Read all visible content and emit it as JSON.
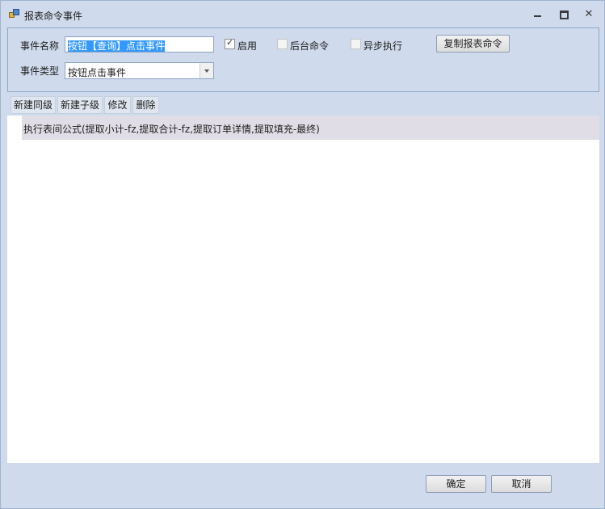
{
  "window": {
    "title": "报表命令事件",
    "icon": "app-window-icon",
    "close_glyph": "✕"
  },
  "form": {
    "event_name_label": "事件名称",
    "event_name_value": "按钮【查询】点击事件",
    "enable_label": "启用",
    "enable_checked": true,
    "background_label": "后台命令",
    "background_checked": false,
    "async_label": "异步执行",
    "async_checked": false,
    "copy_button_label": "复制报表命令",
    "event_type_label": "事件类型",
    "event_type_value": "按钮点击事件"
  },
  "toolbar": {
    "new_sibling": "新建同级",
    "new_child": "新建子级",
    "edit": "修改",
    "delete": "删除"
  },
  "list": {
    "items": [
      {
        "label": "执行表间公式(提取小计-fz,提取合计-fz,提取订单详情,提取填充-最终)"
      }
    ]
  },
  "footer": {
    "ok_label": "确定",
    "cancel_label": "取消"
  },
  "colors": {
    "window_bg": "#cfdbec",
    "selection_bg": "#3399ff",
    "row_highlight": "#e0dde6"
  }
}
